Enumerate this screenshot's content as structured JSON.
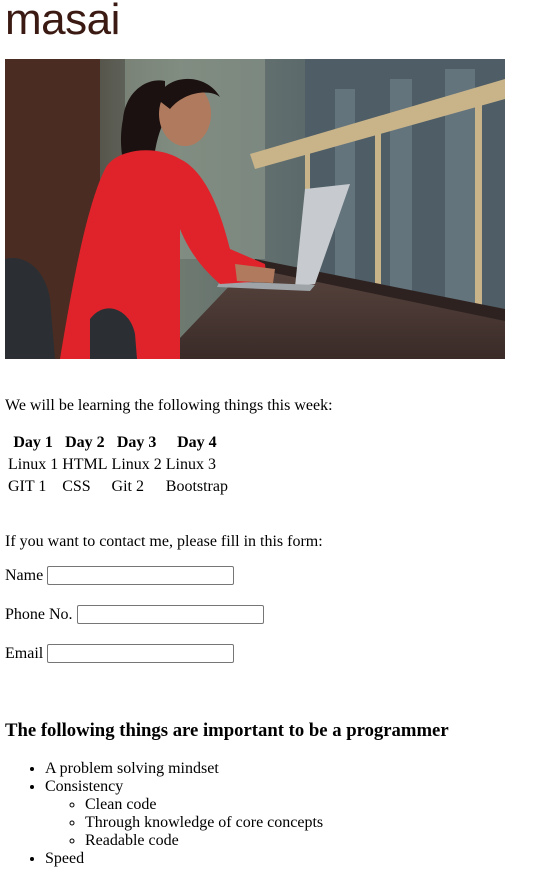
{
  "brand": {
    "logo_text": "masai"
  },
  "hero": {
    "alt": "Woman in red sweater using a laptop"
  },
  "intro_text": "We will be learning the following things this week:",
  "schedule": {
    "headers": [
      "Day 1",
      "Day 2",
      "Day 3",
      "Day 4"
    ],
    "rows": [
      [
        "Linux 1",
        "HTML",
        "Linux 2",
        "Linux 3"
      ],
      [
        "GIT 1",
        "CSS",
        "Git 2",
        "Bootstrap"
      ]
    ]
  },
  "contact": {
    "intro": "If you want to contact me, please fill in this form:",
    "name_label": "Name",
    "name_value": "",
    "phone_label": "Phone No.",
    "phone_value": "",
    "email_label": "Email",
    "email_value": ""
  },
  "programmer": {
    "title": "The following things are important to be a programmer",
    "items": [
      "A problem solving mindset",
      "Consistency",
      "Speed"
    ],
    "sub_items": [
      "Clean code",
      "Through knowledge of core concepts",
      "Readable code"
    ]
  },
  "colors": {
    "logo": "#3a1a12",
    "sweater": "#e0232a",
    "background": "#ffffff"
  }
}
